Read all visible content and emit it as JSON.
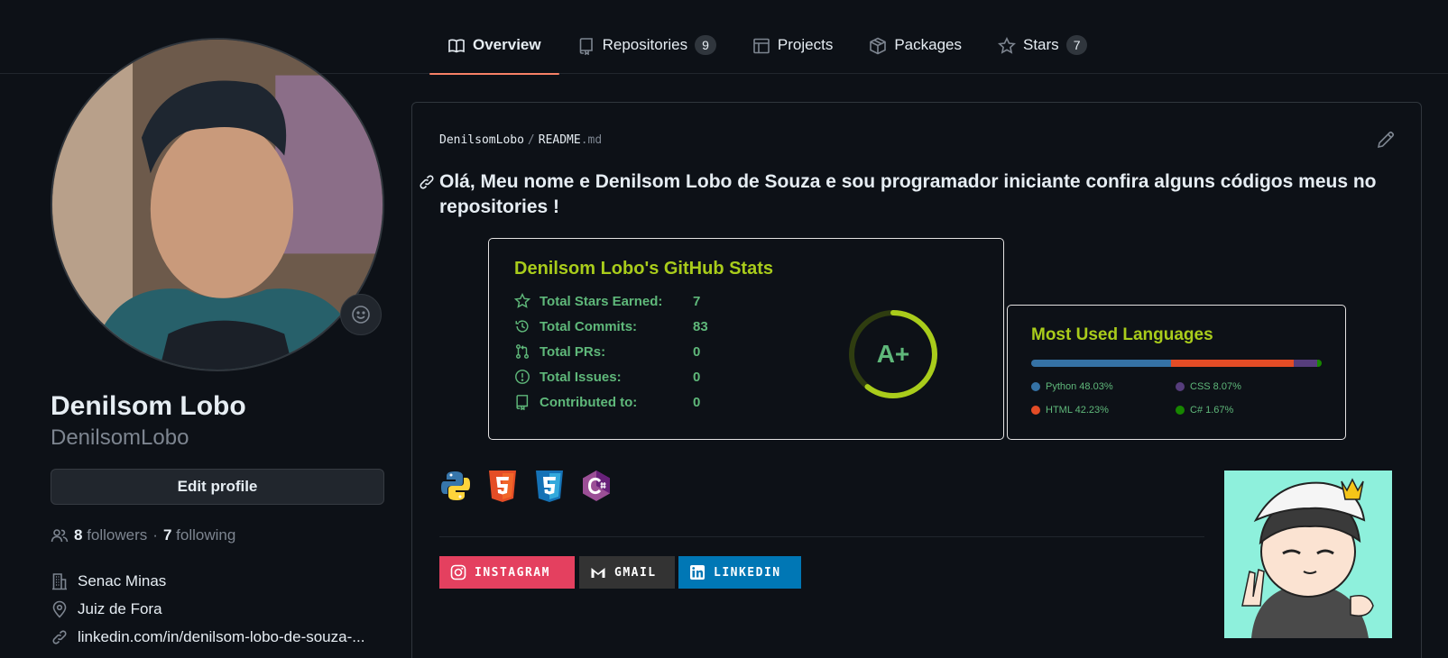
{
  "tabs": [
    {
      "label": "Overview",
      "icon": "book-icon",
      "active": true
    },
    {
      "label": "Repositories",
      "icon": "repo-icon",
      "count": "9"
    },
    {
      "label": "Projects",
      "icon": "table-icon"
    },
    {
      "label": "Packages",
      "icon": "package-icon"
    },
    {
      "label": "Stars",
      "icon": "star-icon",
      "count": "7"
    }
  ],
  "profile": {
    "name": "Denilsom Lobo",
    "username": "DenilsomLobo",
    "edit_label": "Edit profile",
    "followers_count": "8",
    "followers_label": "followers",
    "separator": "·",
    "following_count": "7",
    "following_label": "following",
    "organization": "Senac Minas",
    "location": "Juiz de Fora",
    "link": "linkedin.com/in/denilsom-lobo-de-souza-..."
  },
  "readme": {
    "owner": "DenilsomLobo",
    "slash": "/",
    "file": "README",
    "ext": ".md",
    "heading": "Olá, Meu nome e Denilsom Lobo de Souza e sou programador iniciante confira alguns códigos meus no repositories !"
  },
  "stats_card": {
    "title": "Denilsom Lobo's GitHub Stats",
    "rows": [
      {
        "label": "Total Stars Earned:",
        "value": "7",
        "icon": "star-icon"
      },
      {
        "label": "Total Commits:",
        "value": "83",
        "icon": "history-icon"
      },
      {
        "label": "Total PRs:",
        "value": "0",
        "icon": "pull-request-icon"
      },
      {
        "label": "Total Issues:",
        "value": "0",
        "icon": "issue-icon"
      },
      {
        "label": "Contributed to:",
        "value": "0",
        "icon": "repo-icon"
      }
    ],
    "grade": "A+",
    "title_color": "#a9cc1b",
    "text_color": "#5fb87a"
  },
  "languages_card": {
    "title": "Most Used Languages",
    "languages": [
      {
        "label": "Python 48.03%",
        "percent": 48.03,
        "color": "#3572A5"
      },
      {
        "label": "HTML 42.23%",
        "percent": 42.23,
        "color": "#e34c26"
      },
      {
        "label": "CSS 8.07%",
        "percent": 8.07,
        "color": "#563d7c"
      },
      {
        "label": "C# 1.67%",
        "percent": 1.67,
        "color": "#178600"
      }
    ]
  },
  "tech_icons": [
    "python-icon",
    "html5-icon",
    "css3-icon",
    "csharp-icon"
  ],
  "badges": [
    {
      "label": "INSTAGRAM",
      "icon": "instagram-icon",
      "color": "#E4405F"
    },
    {
      "label": "GMAIL",
      "icon": "gmail-icon",
      "color": "#333333"
    },
    {
      "label": "LINKEDIN",
      "icon": "linkedin-icon",
      "color": "#0077B5"
    }
  ]
}
